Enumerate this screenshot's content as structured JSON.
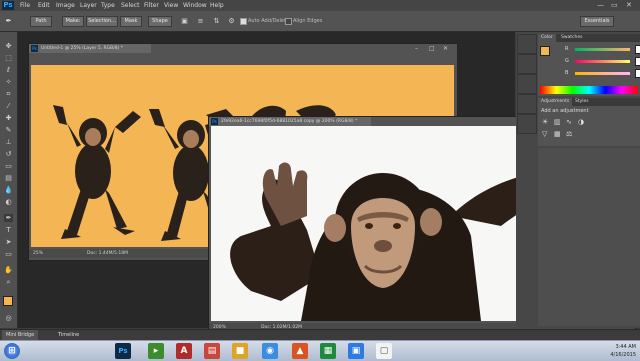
{
  "menu": {
    "logo": "Ps",
    "items": [
      "File",
      "Edit",
      "Image",
      "Layer",
      "Type",
      "Select",
      "Filter",
      "View",
      "Window",
      "Help"
    ],
    "window_controls": [
      "—",
      "▭",
      "✕"
    ]
  },
  "options": {
    "feather_label": "Path",
    "btn_make": "Make:",
    "btn_selection": "Selection...",
    "btn_mask": "Mask",
    "btn_shape": "Shape",
    "auto_add_delete": "Auto Add/Delete",
    "align_edges": "Align Edges",
    "workspace": "Essentials"
  },
  "doc1": {
    "title": "Untitled-1 @ 25% (Layer 5, RGB/8) *",
    "zoom": "25%",
    "status": "Doc: 1.44M/5.18M"
  },
  "doc2": {
    "title": "2fe92ea6-1cc7698f0f5d-6881025a8 copy @ 200% (RGB/8) *",
    "zoom": "200%",
    "status": "Doc: 1.02M/1.02M"
  },
  "panels": {
    "color_tab": "Color",
    "swatches_tab": "Swatches",
    "r_label": "R",
    "g_label": "G",
    "b_label": "B",
    "r_value": "255",
    "g_value": "180",
    "b_value": "101",
    "adjustments_tab": "Adjustments",
    "styles_tab": "Styles",
    "add_adjustment": "Add an adjustment"
  },
  "bottom": {
    "mini_bridge": "Mini Bridge",
    "timeline": "Timeline"
  },
  "taskbar": {
    "time": "3:44 AM",
    "date": "4/16/2015"
  },
  "colors": {
    "doc1_background": "#f4b554",
    "fg_swatch": "#f4b554",
    "ps_blue": "#31a8ff"
  }
}
